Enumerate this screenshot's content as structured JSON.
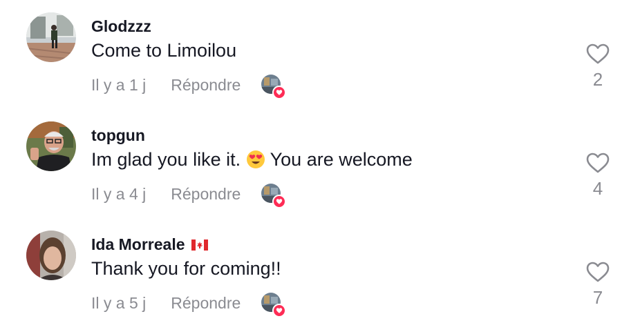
{
  "comments": [
    {
      "username": "Glodzzz",
      "text": "Come to Limoilou",
      "time": "Il y a 1 j",
      "reply_label": "Répondre",
      "likes": "2",
      "avatar_icon": "person-street-photo"
    },
    {
      "username": "topgun",
      "text_before": "Im glad you like it.",
      "text_after": "You are welcome",
      "emoji_icon": "heart-eyes-emoji",
      "time": "Il y a 4 j",
      "reply_label": "Répondre",
      "likes": "4",
      "avatar_icon": "man-with-glasses-photo"
    },
    {
      "username": "Ida Morreale",
      "flag_icon": "canada-flag",
      "text": "Thank you for coming!!",
      "time": "Il y a 5 j",
      "reply_label": "Répondre",
      "likes": "7",
      "avatar_icon": "woman-selfie-photo"
    }
  ],
  "colors": {
    "text": "#161823",
    "secondary": "#8a8b91",
    "accent": "#fe2c55"
  }
}
